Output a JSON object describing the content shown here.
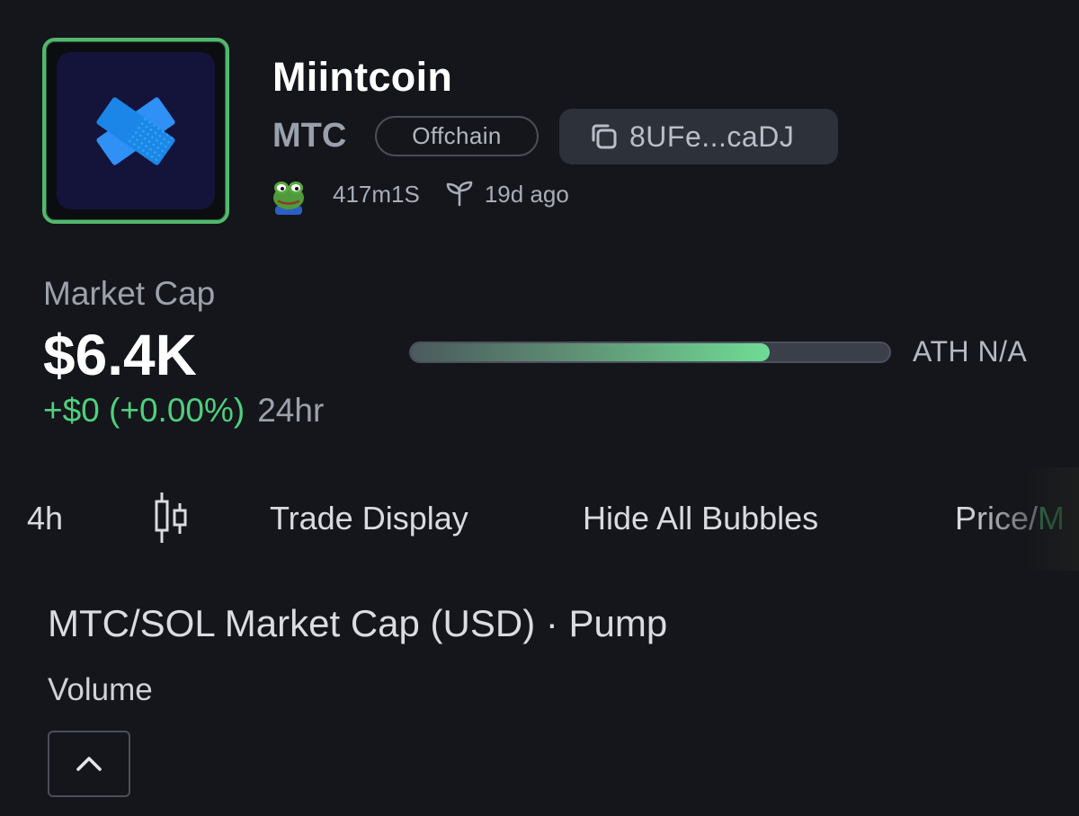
{
  "token": {
    "name": "Miintcoin",
    "symbol": "MTC",
    "badge": "Offchain",
    "address": "8UFe...caDJ",
    "creator": "417m1S",
    "age": "19d ago"
  },
  "market": {
    "label": "Market Cap",
    "value": "$6.4K",
    "change": "+$0 (+0.00%)",
    "period": "24hr",
    "ath_label": "ATH N/A",
    "ath_progress": 0.75
  },
  "toolbar": {
    "interval": "4h",
    "trade_display": "Trade Display",
    "hide_bubbles": "Hide All Bubbles",
    "price_prefix": "Price/",
    "price_suffix": "M"
  },
  "chart": {
    "title": "MTC/SOL Market Cap (USD) · Pump",
    "volume_label": "Volume"
  },
  "colors": {
    "accent_green": "#4fd07e",
    "background": "#15161b",
    "logo_border": "#52b86d"
  }
}
